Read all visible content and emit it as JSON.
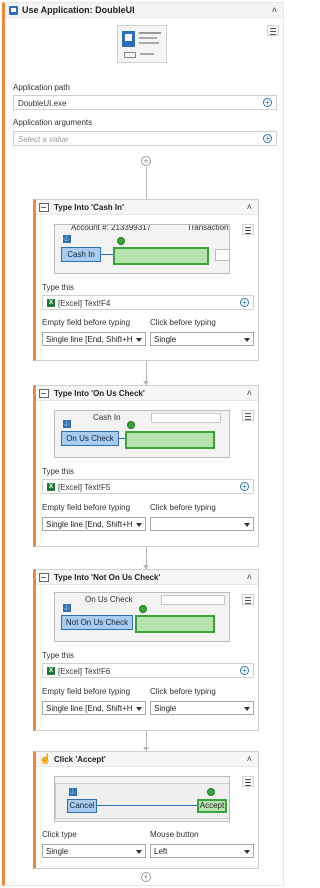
{
  "app": {
    "title": "Use Application: DoubleUI"
  },
  "application_path": {
    "label": "Application path",
    "value": "DoubleUI.exe"
  },
  "application_arguments": {
    "label": "Application arguments",
    "placeholder": "Select a value"
  },
  "type_cash_in": {
    "title": "Type Into 'Cash In'",
    "preview": {
      "account_text": "Account #: 213399317",
      "transaction_text": "Transaction",
      "button": "Cash In"
    },
    "type_this_label": "Type this",
    "type_this_value": "[Excel] Text!F4",
    "empty_field_label": "Empty field before typing",
    "empty_field_value": "Single line [End, Shift+H",
    "click_before_label": "Click before typing",
    "click_before_value": "Single"
  },
  "type_on_us": {
    "title": "Type Into 'On Us Check'",
    "preview": {
      "top_text": "Cash In",
      "button": "On Us Check"
    },
    "type_this_label": "Type this",
    "type_this_value": "[Excel] Text!F5",
    "empty_field_label": "Empty field before typing",
    "empty_field_value": "Single line [End, Shift+H",
    "click_before_label": "Click before typing",
    "click_before_value": ""
  },
  "type_not_on_us": {
    "title": "Type Into 'Not On Us Check'",
    "preview": {
      "top_text": "On Us Check",
      "button": "Not On Us Check"
    },
    "type_this_label": "Type this",
    "type_this_value": "[Excel] Text!F6",
    "empty_field_label": "Empty field before typing",
    "empty_field_value": "Single line [End, Shift+H",
    "click_before_label": "Click before typing",
    "click_before_value": "Single"
  },
  "click_accept": {
    "title": "Click 'Accept'",
    "preview": {
      "left_button": "Cancel",
      "right_button": "Accept"
    },
    "click_type_label": "Click type",
    "click_type_value": "Single",
    "mouse_button_label": "Mouse button",
    "mouse_button_value": "Left"
  },
  "icons": {
    "collapse": "chevron-up-icon",
    "menu": "hamburger-menu-icon",
    "add": "plus-circle-icon",
    "dropdown": "caret-down-icon",
    "excel": "excel-icon"
  },
  "colors": {
    "accent_orange": "#f0883b",
    "anchor_blue": "#2c6fb8",
    "target_green": "#3ca33c"
  }
}
